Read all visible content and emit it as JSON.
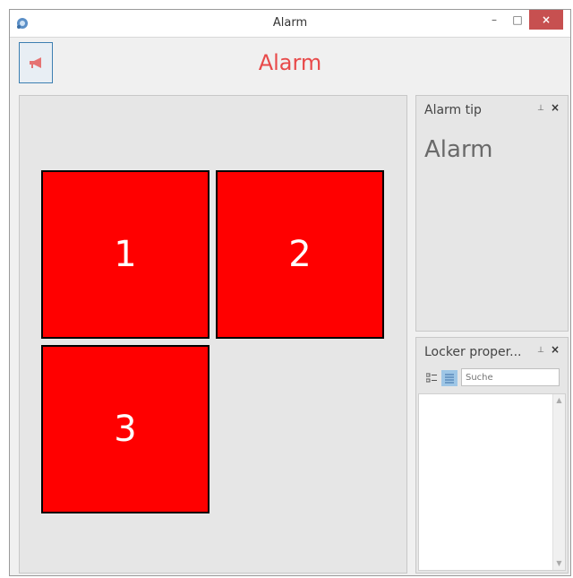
{
  "window": {
    "title": "Alarm",
    "minimize_glyph": "–",
    "maximize_glyph": "□",
    "close_glyph": "×"
  },
  "header": {
    "title": "Alarm",
    "accent_color": "#e84a4a"
  },
  "lockers": [
    {
      "label": "1",
      "color": "#ff0000"
    },
    {
      "label": "2",
      "color": "#ff0000"
    },
    {
      "label": "3",
      "color": "#ff0000"
    }
  ],
  "alarm_tip": {
    "title": "Alarm tip",
    "text": "Alarm",
    "pin_glyph": "⊥",
    "close_glyph": "×"
  },
  "locker_properties": {
    "title": "Locker proper...",
    "pin_glyph": "⊥",
    "close_glyph": "×",
    "search_placeholder": "Suche",
    "icons": [
      "categorized-icon",
      "list-icon"
    ]
  }
}
